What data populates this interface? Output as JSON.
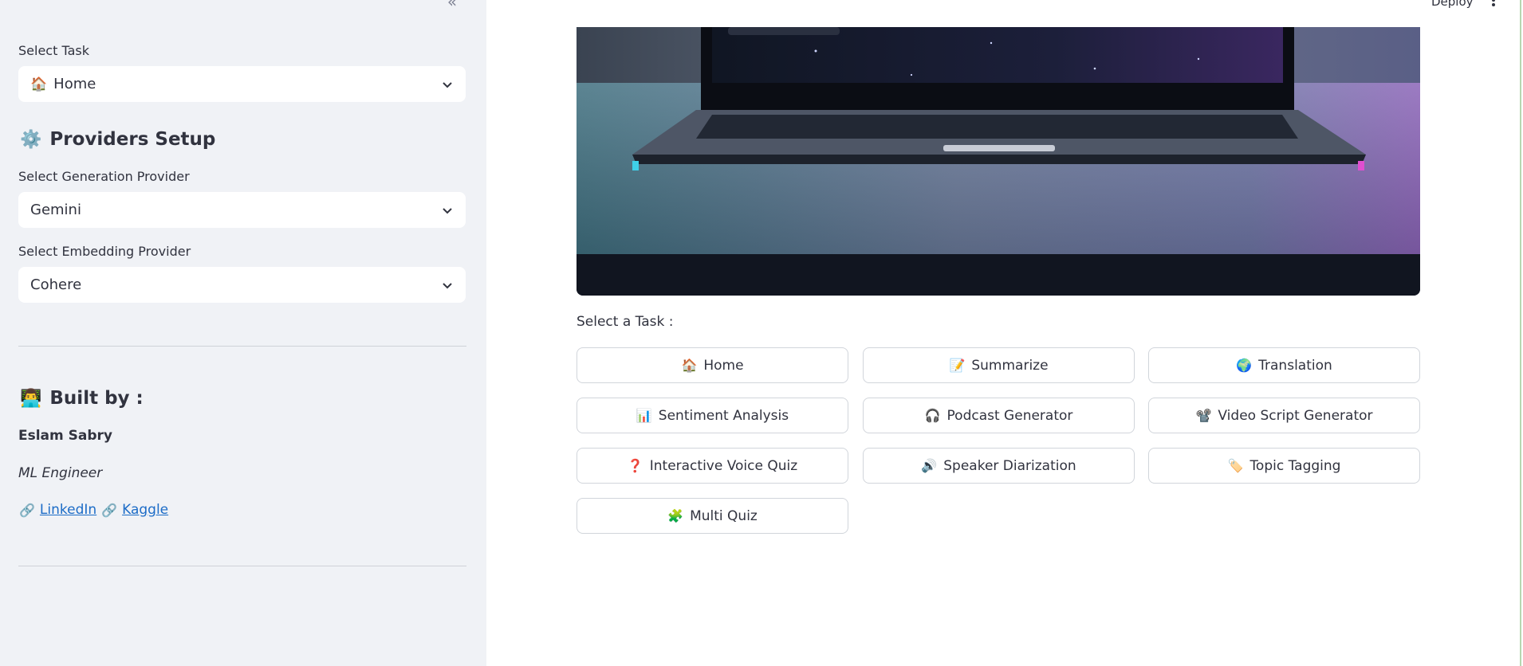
{
  "sidebar": {
    "collapse_glyph": "«",
    "select_task": {
      "label": "Select Task",
      "emoji": "🏠",
      "value": "Home"
    },
    "providers": {
      "emoji": "⚙️",
      "title": "Providers Setup",
      "generation": {
        "label": "Select Generation Provider",
        "value": "Gemini"
      },
      "embedding": {
        "label": "Select Embedding Provider",
        "value": "Cohere"
      }
    },
    "built_by": {
      "emoji": "👨‍💻",
      "title": "Built by :",
      "name": "Eslam Sabry",
      "role": "ML Engineer",
      "link_icon": "🔗",
      "links": [
        "LinkedIn",
        "Kaggle"
      ]
    }
  },
  "header": {
    "deploy_label": "Deploy"
  },
  "main": {
    "hero_image": "laptop-on-desk-image",
    "select_task_label": "Select a Task :",
    "tasks": [
      {
        "emoji": "🏠",
        "label": "Home"
      },
      {
        "emoji": "📝",
        "label": "Summarize"
      },
      {
        "emoji": "🌍",
        "label": "Translation"
      },
      {
        "emoji": "📊",
        "label": "Sentiment Analysis"
      },
      {
        "emoji": "🎧",
        "label": "Podcast Generator"
      },
      {
        "emoji": "📽️",
        "label": "Video Script Generator"
      },
      {
        "emoji": "❓",
        "label": "Interactive Voice Quiz"
      },
      {
        "emoji": "🔊",
        "label": "Speaker Diarization"
      },
      {
        "emoji": "🏷️",
        "label": "Topic Tagging"
      },
      {
        "emoji": "🧩",
        "label": "Multi Quiz"
      }
    ]
  }
}
